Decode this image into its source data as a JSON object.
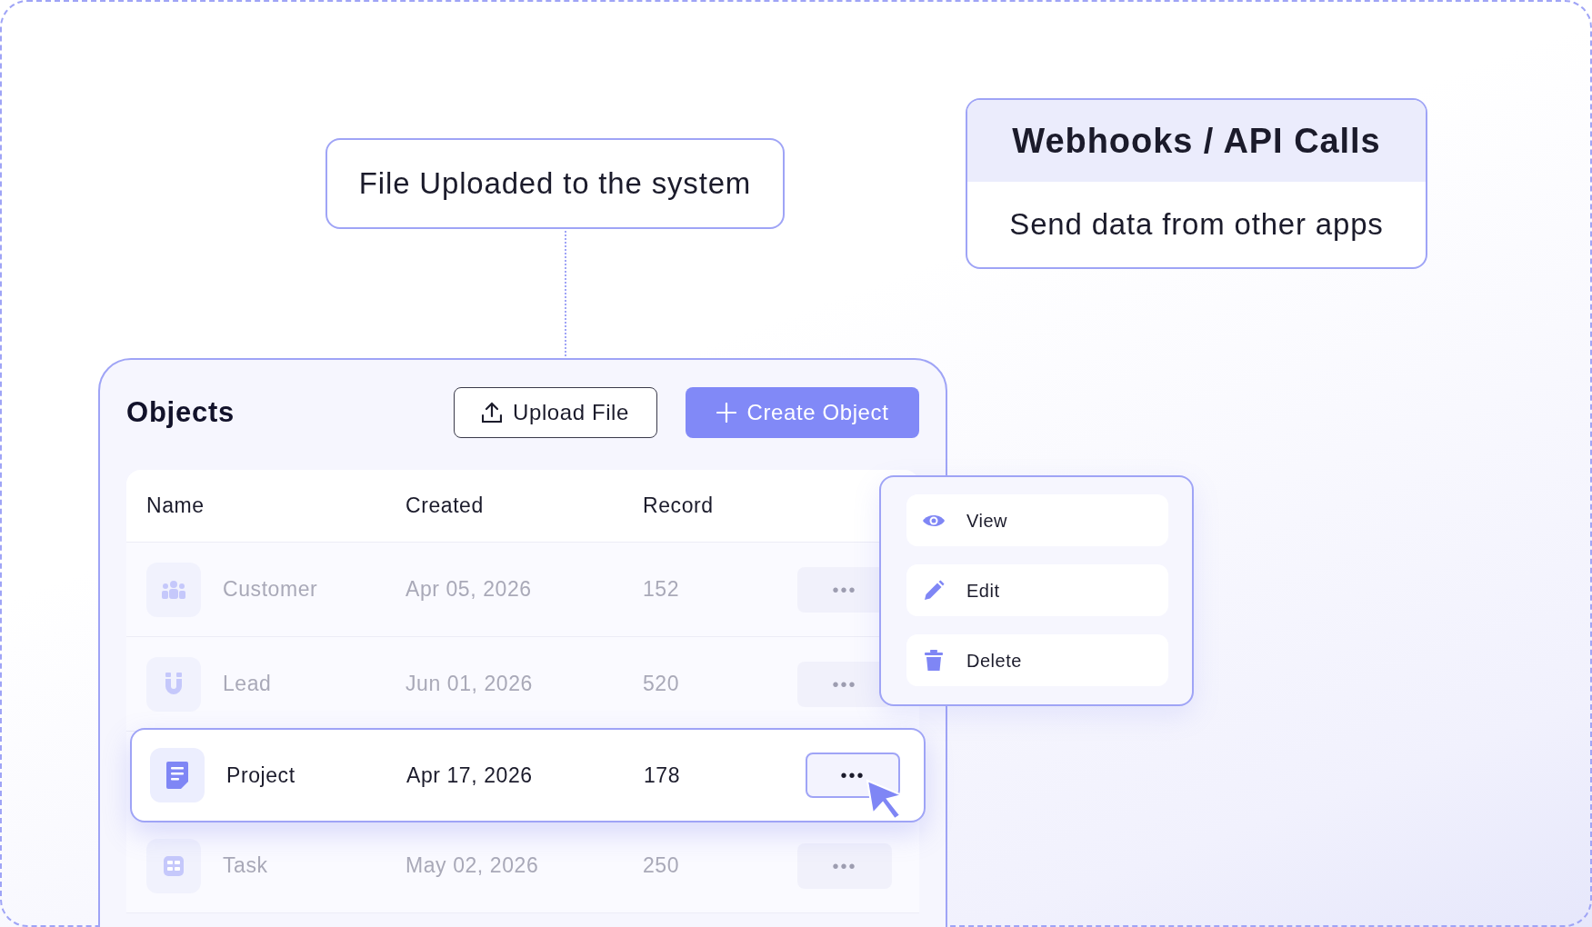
{
  "trigger_card": {
    "text": "File Uploaded to the system"
  },
  "source_card": {
    "title": "Webhooks / API Calls",
    "subtitle": "Send data from other apps"
  },
  "panel": {
    "title": "Objects",
    "buttons": [
      {
        "label": "Upload File",
        "kind": "outline"
      },
      {
        "label": "Create Object",
        "kind": "primary"
      }
    ]
  },
  "table": {
    "columns": [
      "Name",
      "Created",
      "Record"
    ],
    "rows": [
      {
        "name": "Customer",
        "created": "Apr 05, 2026",
        "record": "152",
        "actions": "•••",
        "selected": false
      },
      {
        "name": "Lead",
        "created": "Jun 01, 2026",
        "record": "520",
        "actions": "•••",
        "selected": false
      },
      {
        "name": "Project",
        "created": "Apr 17, 2026",
        "record": "178",
        "actions": "•••",
        "selected": true
      },
      {
        "name": "Task",
        "created": "May 02, 2026",
        "record": "250",
        "actions": "•••",
        "selected": false
      }
    ]
  },
  "context_menu": {
    "items": [
      {
        "label": "View",
        "kind": "view"
      },
      {
        "label": "Edit",
        "kind": "edit"
      },
      {
        "label": "Delete",
        "kind": "delete"
      }
    ]
  }
}
